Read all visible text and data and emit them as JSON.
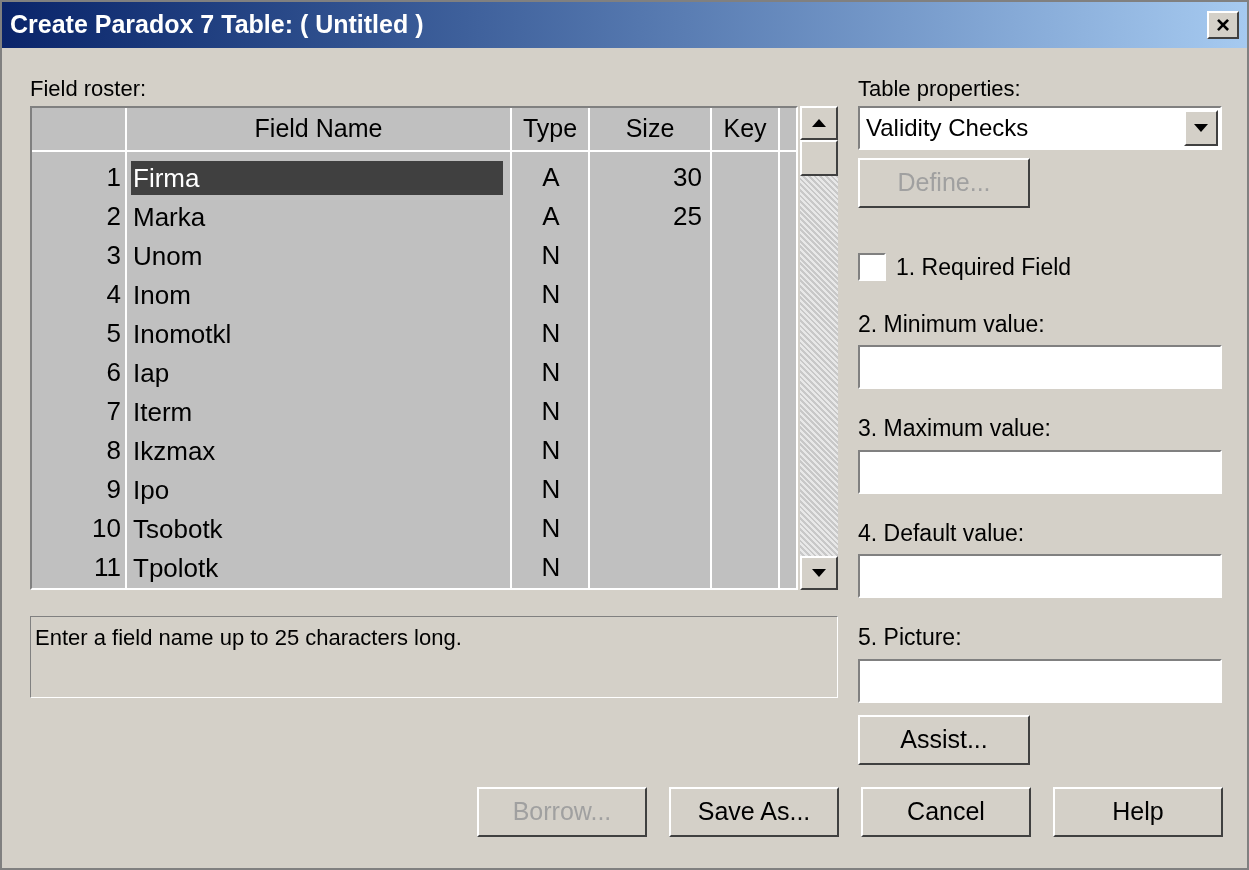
{
  "window": {
    "title": "Create Paradox 7 Table:  ( Untitled )",
    "close": "×"
  },
  "field_roster": {
    "label": "Field roster:",
    "columns": [
      "Field Name",
      "Type",
      "Size",
      "Key"
    ],
    "rows": [
      {
        "number": "1",
        "name": "Firma",
        "type": "A",
        "size": "30",
        "selected": true
      },
      {
        "number": "2",
        "name": "Marka",
        "type": "A",
        "size": "25",
        "selected": false
      },
      {
        "number": "3",
        "name": "Unom",
        "type": "N",
        "selected": false
      },
      {
        "number": "4",
        "name": "Inom",
        "type": "N",
        "selected": false
      },
      {
        "number": "5",
        "name": "Inomotkl",
        "type": "N",
        "selected": false
      },
      {
        "number": "6",
        "name": "Iap",
        "type": "N",
        "selected": false
      },
      {
        "number": "7",
        "name": "Iterm",
        "type": "N",
        "selected": false
      },
      {
        "number": "8",
        "name": "Ikzmax",
        "type": "N",
        "selected": false
      },
      {
        "number": "9",
        "name": "Ipo",
        "type": "N",
        "selected": false
      },
      {
        "number": "10",
        "name": "Tsobotk",
        "type": "N",
        "selected": false
      },
      {
        "number": "11",
        "name": "Tpolotk",
        "type": "N",
        "selected": false
      }
    ]
  },
  "hint": "Enter a field name up to 25 characters long.",
  "table_properties": {
    "label": "Table properties:",
    "value": "Validity Checks"
  },
  "define_button": {
    "label": "Define...",
    "disabled": true
  },
  "required_field": {
    "label": "1. Required Field",
    "checked": false
  },
  "fields": [
    {
      "label": "2. Minimum value:"
    },
    {
      "label": "3. Maximum value:"
    },
    {
      "label": "4. Default value:"
    },
    {
      "label": "5. Picture:"
    }
  ],
  "assist_button": {
    "label": "Assist...",
    "disabled": false
  },
  "buttons": [
    {
      "label": "Borrow...",
      "disabled": true
    },
    {
      "label": "Save As...",
      "disabled": false
    },
    {
      "label": "Cancel",
      "disabled": false
    },
    {
      "label": "Help",
      "disabled": false
    }
  ]
}
